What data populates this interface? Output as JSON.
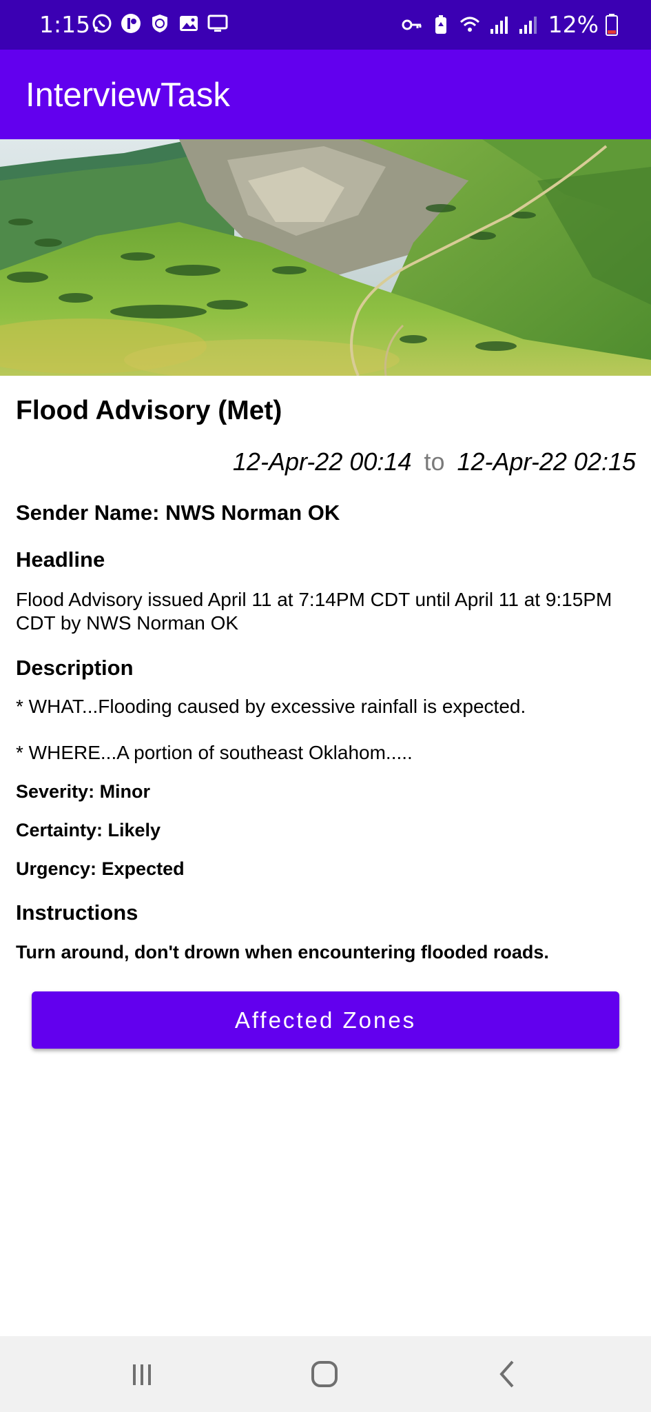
{
  "status_bar": {
    "time": "1:15",
    "battery": "12%",
    "left_icons": [
      "whatsapp-icon",
      "app-icon",
      "shield-icon",
      "gallery-icon",
      "cast-icon"
    ],
    "right_icons": [
      "key-icon",
      "battery-saver-icon",
      "wifi-icon",
      "signal-icon",
      "signal-icon",
      "battery-icon"
    ],
    "colors": {
      "background": "#3b00b3",
      "battery_low": "#e53935"
    }
  },
  "app_bar": {
    "title": "InterviewTask",
    "background": "#6200ee"
  },
  "hero": {
    "icon": "landscape-image"
  },
  "alert": {
    "title": "Flood Advisory (Met)",
    "start": "12-Apr-22 00:14",
    "to_label": "to",
    "end": "12-Apr-22 02:15",
    "sender_line": "Sender Name: NWS Norman OK",
    "headline_label": "Headline",
    "headline_text": "Flood Advisory issued April 11 at 7:14PM CDT until April 11 at 9:15PM CDT by NWS Norman OK",
    "description_label": "Description",
    "description_line1": "* WHAT...Flooding caused by excessive rainfall is expected.",
    "description_line2": "* WHERE...A portion of southeast Oklahom.....",
    "severity": "Severity: Minor",
    "certainty": "Certainty: Likely",
    "urgency": "Urgency: Expected",
    "instructions_label": "Instructions",
    "instructions_text": "Turn around, don't drown when encountering flooded roads."
  },
  "actions": {
    "affected_zones": "Affected Zones",
    "accent": "#6200ee"
  },
  "nav_bar": {
    "icons": [
      "recent-apps-icon",
      "home-icon",
      "back-icon"
    ]
  }
}
